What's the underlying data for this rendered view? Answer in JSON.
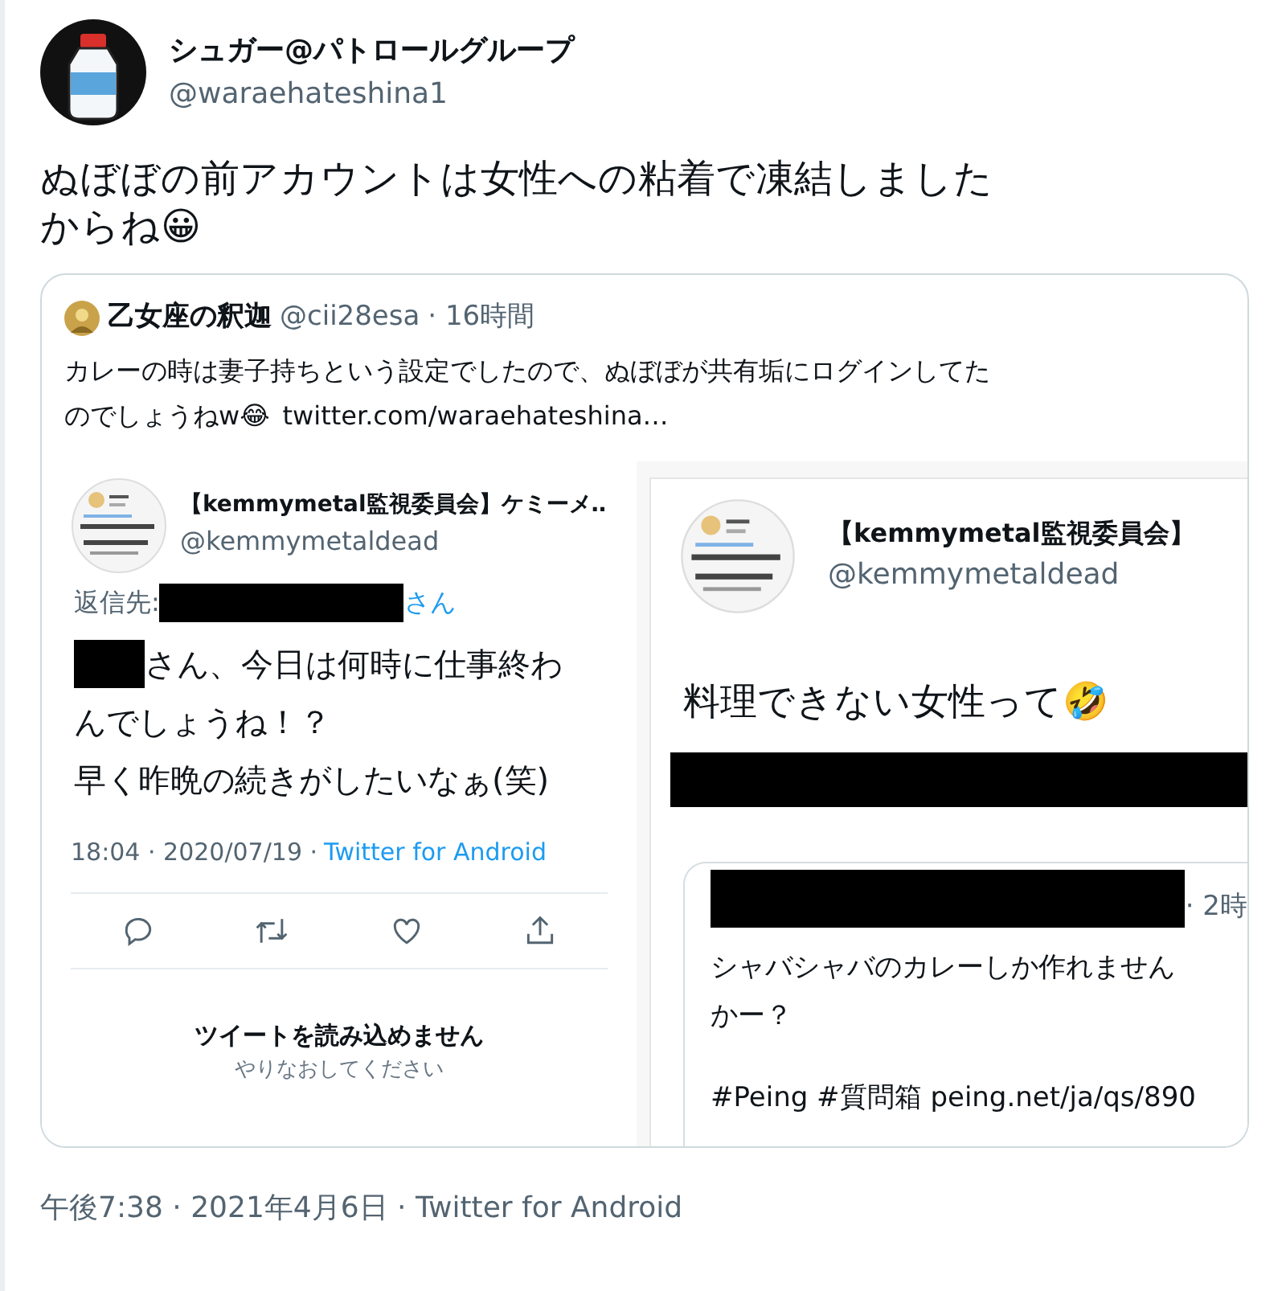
{
  "tweet": {
    "name": "シュガー@パトロールグループ",
    "handle": "@waraehateshina1",
    "lines": [
      "ぬぼぼの前アカウントは女性への粘着で凍結しました",
      "からね😀"
    ]
  },
  "quote": {
    "name": "乙女座の釈迦",
    "handle": "@cii28esa",
    "time": "· 16時間",
    "line_1": "カレーの時は妻子持ちという設定でしたので、ぬぼぼが共有垢にログインしてた",
    "line_2": "のでしょうねw😂",
    "link": "twitter.com/waraehateshina…"
  },
  "left_shot": {
    "name": "【kemmymetal監視委員会】ケミーメ‥",
    "handle": "@kemmymetaldead",
    "reply_prefix": "返信先:",
    "reply_suffix": "さん",
    "lines": [
      {
        "redacted_prefix": true,
        "text": "さん、今日は何時に仕事終わ"
      },
      {
        "redacted_prefix": false,
        "text": "んでしょうね！？"
      },
      {
        "redacted_prefix": false,
        "text": "早く昨晩の続きがしたいなぁ(笑)"
      }
    ],
    "meta": "18:04 · 2020/07/19 ·",
    "source": "Twitter for Android",
    "error_title": "ツイートを読み込めません",
    "error_sub": "やりなおしてください"
  },
  "right_shot": {
    "name": "【kemmymetal監視委員会】",
    "handle": "@kemmymetaldead",
    "text": "料理できない女性って🤣",
    "inner": {
      "time": "· 2時",
      "lines": [
        "シャバシャバのカレーしか作れません",
        "かー？"
      ],
      "footer": "#Peing #質問箱 peing.net/ja/qs/890"
    }
  },
  "footer": "午後7:38 · 2021年4月6日 · Twitter for Android"
}
